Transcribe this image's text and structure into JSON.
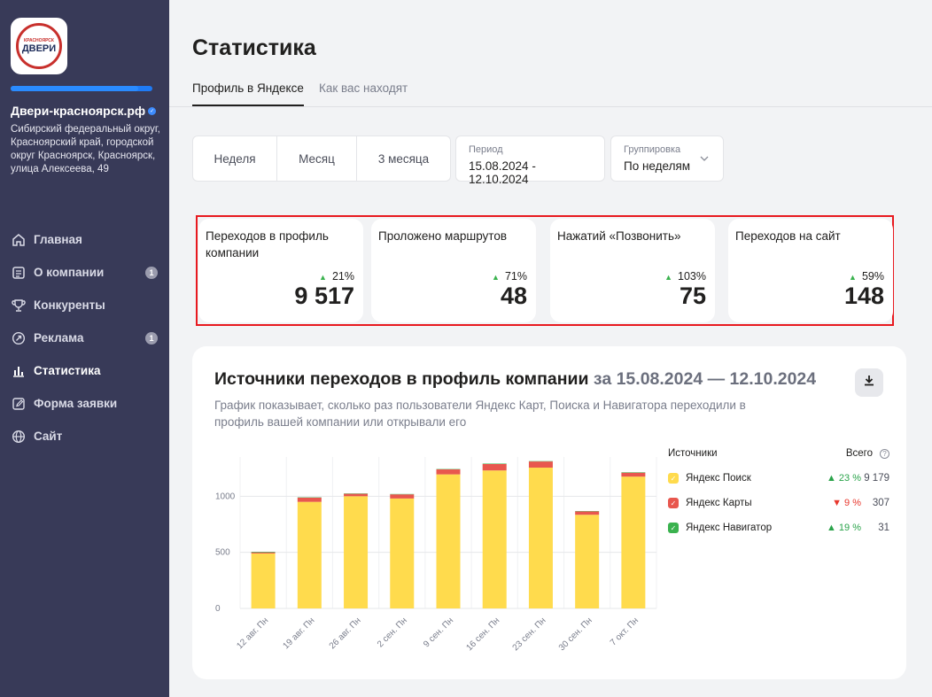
{
  "sidebar": {
    "logo": {
      "small": "КРАСНОЯРСК",
      "big": "ДВЕРИ"
    },
    "progress": 0.9,
    "company_name": "Двери-красноярск.рф",
    "company_address": "Сибирский федеральный округ, Красноярский край, городской округ Красноярск, Красноярск, улица Алексеева, 49",
    "nav": [
      {
        "label": "Главная",
        "icon": "home-icon",
        "badge": ""
      },
      {
        "label": "О компании",
        "icon": "document-icon",
        "badge": "1"
      },
      {
        "label": "Конкуренты",
        "icon": "trophy-icon",
        "badge": ""
      },
      {
        "label": "Реклама",
        "icon": "ad-icon",
        "badge": "1"
      },
      {
        "label": "Статистика",
        "icon": "bar-chart-icon",
        "badge": "",
        "active": true
      },
      {
        "label": "Форма заявки",
        "icon": "edit-icon",
        "badge": ""
      },
      {
        "label": "Сайт",
        "icon": "globe-icon",
        "badge": ""
      }
    ]
  },
  "page": {
    "title": "Статистика",
    "tabs": [
      {
        "label": "Профиль в Яндексе",
        "active": true
      },
      {
        "label": "Как вас находят",
        "active": false
      }
    ],
    "period_buttons": [
      "Неделя",
      "Месяц",
      "3 месяца"
    ],
    "period": {
      "label": "Период",
      "value": "15.08.2024 - 12.10.2024"
    },
    "grouping": {
      "label": "Группировка",
      "value": "По неделям"
    }
  },
  "kpis": [
    {
      "label": "Переходов в профиль компании",
      "delta": "21%",
      "value": "9 517"
    },
    {
      "label": "Проложено маршрутов",
      "delta": "71%",
      "value": "48"
    },
    {
      "label": "Нажатий «Позвонить»",
      "delta": "103%",
      "value": "75"
    },
    {
      "label": "Переходов на сайт",
      "delta": "59%",
      "value": "148"
    }
  ],
  "sources_card": {
    "title": "Источники переходов в профиль компании",
    "range": "за 15.08.2024 — 12.10.2024",
    "subtitle": "График показывает, сколько раз пользователи Яндекс Карт, Поиска и Навигатора переходили в профиль вашей компании или открывали его",
    "legend_header": {
      "sources": "Источники",
      "total": "Всего"
    },
    "legend": [
      {
        "name": "Яндекс Поиск",
        "delta": "▲ 23 %",
        "total": "9 179",
        "color": "#ffdb4d",
        "delta_color": "#2aa34a"
      },
      {
        "name": "Яндекс Карты",
        "delta": "▼ 9 %",
        "total": "307",
        "color": "#e8574e",
        "delta_color": "#e8382e"
      },
      {
        "name": "Яндекс Навигатор",
        "delta": "▲ 19 %",
        "total": "31",
        "color": "#3ab24e",
        "delta_color": "#2aa34a"
      }
    ]
  },
  "chart_data": {
    "type": "bar",
    "stacked": true,
    "categories": [
      "12 авг. Пн",
      "19 авг. Пн",
      "26 авг. Пн",
      "2 сен. Пн",
      "9 сен. Пн",
      "16 сен. Пн",
      "23 сен. Пн",
      "30 сен. Пн",
      "7 окт. Пн"
    ],
    "series": [
      {
        "name": "Яндекс Поиск",
        "color": "#ffdb4d",
        "values": [
          490,
          950,
          1000,
          980,
          1195,
          1230,
          1255,
          835,
          1175
        ]
      },
      {
        "name": "Яндекс Карты",
        "color": "#e8574e",
        "values": [
          10,
          38,
          22,
          37,
          45,
          57,
          55,
          30,
          35
        ]
      },
      {
        "name": "Яндекс Навигатор",
        "color": "#3ab24e",
        "values": [
          5,
          3,
          3,
          3,
          3,
          4,
          3,
          3,
          4
        ]
      }
    ],
    "yticks": [
      0,
      500,
      1000
    ],
    "ylim": [
      0,
      1350
    ],
    "grid": true
  }
}
